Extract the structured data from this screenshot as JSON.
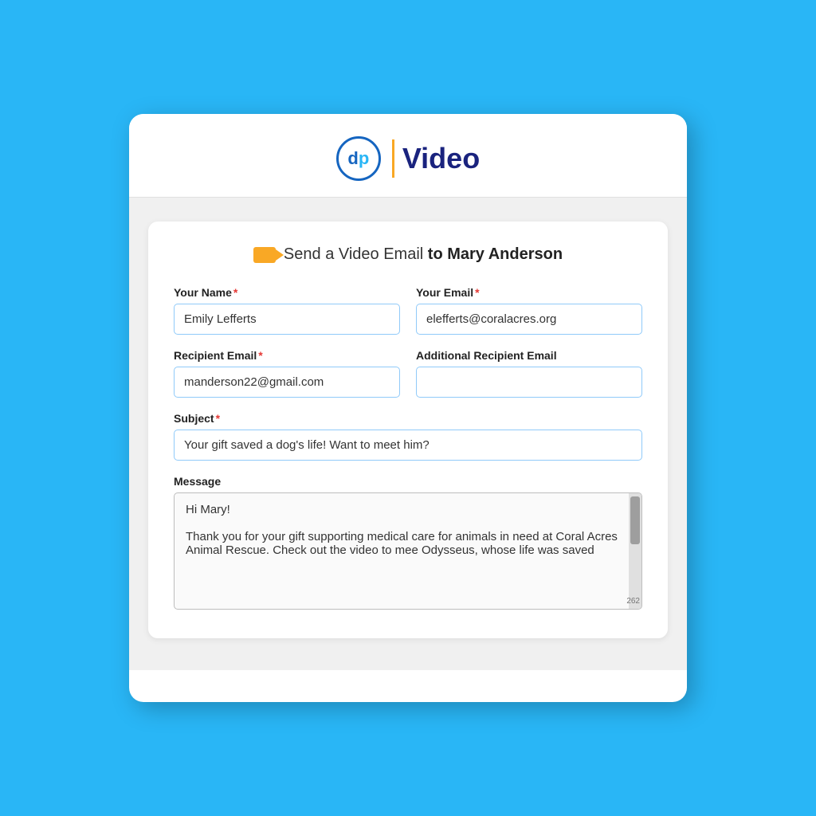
{
  "header": {
    "logo_dp": "dp",
    "logo_text": "Video"
  },
  "form": {
    "title_prefix": "Send a Video Email ",
    "title_suffix": "to Mary Anderson",
    "video_icon_label": "video-camera",
    "your_name_label": "Your Name",
    "your_name_required": "*",
    "your_name_value": "Emily Lefferts",
    "your_email_label": "Your Email",
    "your_email_required": "*",
    "your_email_value": "elefferts@coralacres.org",
    "recipient_email_label": "Recipient Email",
    "recipient_email_required": "*",
    "recipient_email_value": "manderson22@gmail.com",
    "additional_recipient_label": "Additional Recipient Email",
    "additional_recipient_value": "",
    "subject_label": "Subject",
    "subject_required": "*",
    "subject_value": "Your gift saved a dog's life! Want to meet him?",
    "message_label": "Message",
    "message_value": "Hi Mary!\n\nThank you for your gift supporting medical care for animals in need at Coral Acres Animal Rescue. Check out the video to mee Odysseus, whose life was saved",
    "scroll_counter": "262"
  }
}
